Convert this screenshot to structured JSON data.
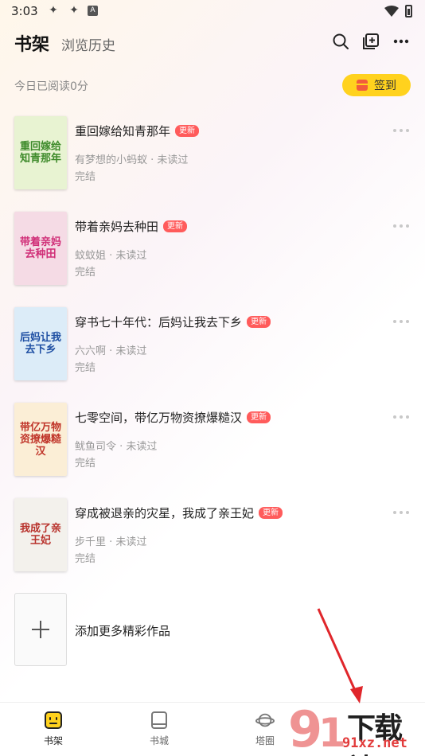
{
  "status_bar": {
    "time": "3:03",
    "left_icons": [
      "app-icon-1",
      "app-icon-2",
      "a-icon"
    ],
    "a_label": "A"
  },
  "header": {
    "tab_shelf": "书架",
    "tab_history": "浏览历史"
  },
  "reading": {
    "today_text": "今日已阅读0分",
    "signin_label": "签到"
  },
  "books": [
    {
      "title": "重回嫁给知青那年",
      "badge": "更新",
      "meta": "有梦想的小蚂蚁 · 未读过",
      "status": "完结",
      "cover_text": "重回嫁给知青那年",
      "cover_bg": "#e8f3d2",
      "cover_color": "#3d8a2a"
    },
    {
      "title": "带着亲妈去种田",
      "badge": "更新",
      "meta": "蚊蚊姐 · 未读过",
      "status": "完结",
      "cover_text": "带着亲妈去种田",
      "cover_bg": "#f5dbe5",
      "cover_color": "#d02f78"
    },
    {
      "title": "穿书七十年代：后妈让我去下乡",
      "badge": "更新",
      "meta": "六六啊 · 未读过",
      "status": "完结",
      "cover_text": "后妈让我去下乡",
      "cover_bg": "#dcecf8",
      "cover_color": "#1e4fa3"
    },
    {
      "title": "七零空间，带亿万物资撩爆糙汉",
      "badge": "更新",
      "meta": "鱿鱼司令 · 未读过",
      "status": "完结",
      "cover_text": "带亿万物资撩爆糙汉",
      "cover_bg": "#fbeed6",
      "cover_color": "#c0352a"
    },
    {
      "title": "穿成被退亲的灾星，我成了亲王妃",
      "badge": "更新",
      "meta": "步千里 · 未读过",
      "status": "完结",
      "cover_text": "我成了亲王妃",
      "cover_bg": "#f3f1ec",
      "cover_color": "#b8322c"
    }
  ],
  "add_more": {
    "label": "添加更多精彩作品"
  },
  "bottom_nav": [
    {
      "label": "书架",
      "icon": "bookshelf-icon",
      "active": true
    },
    {
      "label": "书城",
      "icon": "book-icon",
      "active": false
    },
    {
      "label": "塔圈",
      "icon": "planet-icon",
      "active": false
    }
  ],
  "watermark": {
    "big": "下载站",
    "small": "91xz.net"
  },
  "colors": {
    "accent_yellow": "#ffd21e",
    "badge_red": "#ff5b5b",
    "arrow_red": "#e0262b"
  }
}
